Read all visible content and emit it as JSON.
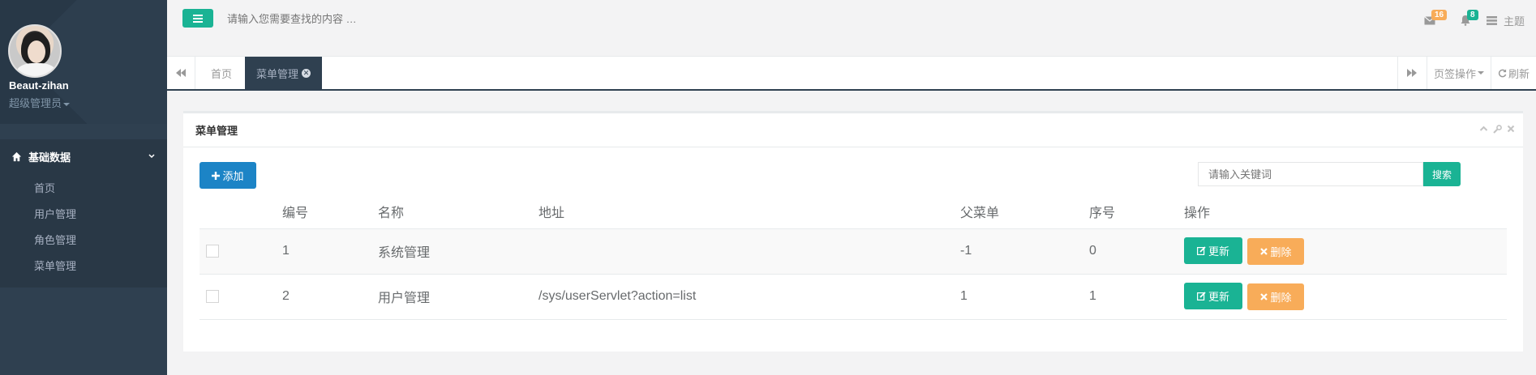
{
  "sidebar": {
    "username": "Beaut-zihan",
    "role": "超级管理员",
    "section": "基础数据",
    "items": [
      {
        "label": "首页"
      },
      {
        "label": "用户管理"
      },
      {
        "label": "角色管理"
      },
      {
        "label": "菜单管理"
      }
    ]
  },
  "topbar": {
    "search_placeholder": "请输入您需要查找的内容 …",
    "mail_count": "16",
    "bell_count": "8",
    "theme_label": "主题"
  },
  "tabs": {
    "home": "首页",
    "active": "菜单管理",
    "page_ops": "页签操作",
    "refresh": "刷新"
  },
  "panel": {
    "title": "菜单管理",
    "add_label": "添加",
    "keyword_placeholder": "请输入关键词",
    "search_label": "搜索"
  },
  "table": {
    "headers": [
      "编号",
      "名称",
      "地址",
      "父菜单",
      "序号",
      "操作"
    ],
    "rows": [
      {
        "id": "1",
        "name": "系统管理",
        "url": "",
        "parent": "-1",
        "order": "0"
      },
      {
        "id": "2",
        "name": "用户管理",
        "url": "/sys/userServlet?action=list",
        "parent": "1",
        "order": "1"
      }
    ],
    "update_label": "更新",
    "delete_label": "删除"
  },
  "colors": {
    "sidebar_bg": "#2f4050",
    "primary": "#1ab394",
    "info": "#1c84c6",
    "warning": "#f8ac59"
  }
}
